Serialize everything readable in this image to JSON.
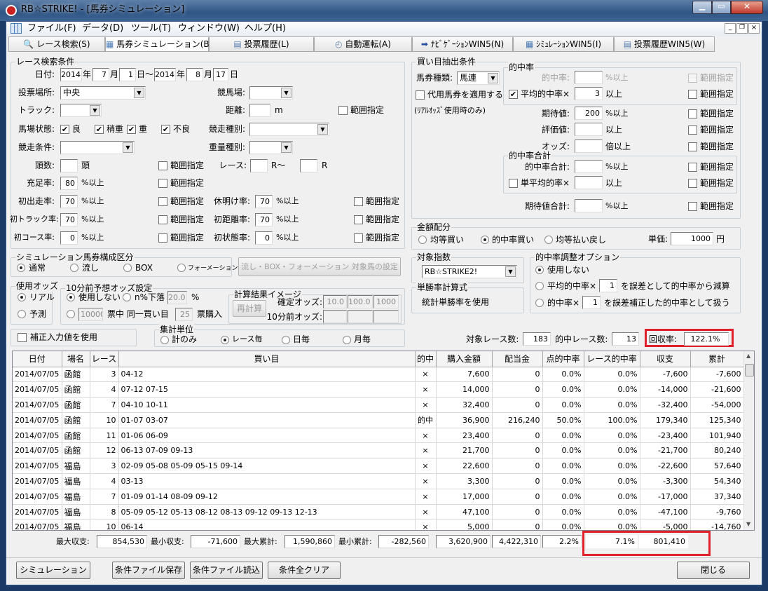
{
  "window": {
    "title": "RB☆STRIKE! - [馬券シミュレーション]",
    "controls": [
      "minimize",
      "maximize",
      "close"
    ]
  },
  "menu": [
    "ファイル(F)",
    "データ(D)",
    "ツール(T)",
    "ウィンドウ(W)",
    "ヘルプ(H)"
  ],
  "tabs": [
    {
      "label": "レース検索(S)",
      "icon": "search-icon"
    },
    {
      "label": "馬券シミュレーション(B)",
      "icon": "grid-icon"
    },
    {
      "label": "投票履歴(L)",
      "icon": "document-icon"
    },
    {
      "label": "自動運転(A)",
      "icon": "clock-icon"
    },
    {
      "label": "ﾅﾋﾞｹﾞｰｼｮﾝWIN5(N)",
      "icon": "arrow-icon"
    },
    {
      "label": "ｼﾐｭﾚｰｼｮﾝWIN5(I)",
      "icon": "grid-icon"
    },
    {
      "label": "投票履歴WIN5(W)",
      "icon": "document-icon"
    }
  ],
  "race": {
    "title": "レース検索条件",
    "date_label": "日付:",
    "y1": "2014",
    "nen": "年",
    "m1": "7",
    "gatsu": "月",
    "d1": "1",
    "nichi_kara": "日～",
    "y2": "2014",
    "m2": "8",
    "d2": "17",
    "nichi": "日",
    "venue_label": "投票場所:",
    "venue": "中央",
    "course_label": "競馬場:",
    "course": "",
    "track_label": "トラック:",
    "track": "",
    "dist_label": "距離:",
    "dist": "",
    "dist_unit": "m",
    "range": "範囲指定",
    "cond_label": "馬場状態:",
    "conds": [
      {
        "label": "良",
        "checked": true
      },
      {
        "label": "稍重",
        "checked": true
      },
      {
        "label": "重",
        "checked": true
      },
      {
        "label": "不良",
        "checked": true
      }
    ],
    "type_label": "競走種別:",
    "type": "",
    "race_cond_label": "競走条件:",
    "race_cond": "",
    "weight_label": "重量種別:",
    "weight": "",
    "heads_label": "頭数:",
    "heads": "",
    "heads_unit": "頭",
    "race_label": "レース:",
    "race_from": "",
    "r_from": "R～",
    "race_to": "",
    "r_to": "R",
    "fill_label": "充足率:",
    "fill": "80",
    "pct_up": "%以上",
    "first_run_label": "初出走率:",
    "first_run": "70",
    "rest_label": "休明け率:",
    "rest": "70",
    "first_track_label": "初トラック率:",
    "first_track": "70",
    "first_dist_label": "初距離率:",
    "first_dist": "70",
    "first_course_label": "初コース率:",
    "first_course": "0",
    "first_state_label": "初状態率:",
    "first_state": "0"
  },
  "sim": {
    "title": "シミュレーション馬券構成区分",
    "options": [
      "通常",
      "流し",
      "BOX",
      "フォーメーション"
    ],
    "selected": "通常",
    "setup_button": "流し・BOX・フォーメーション 対象馬の設定"
  },
  "odds": {
    "title": "使用オッズ",
    "options": [
      "リアル",
      "予測"
    ],
    "selected": "リアル"
  },
  "pre10": {
    "title": "10分前予想オッズ設定",
    "none": "使用しない",
    "drop": "n%下落",
    "drop_val": "20.0",
    "pct": "%",
    "count": "10000",
    "mid": "票中 同一買い目",
    "buy": "25",
    "buy_unit": "票購入",
    "selected": "使用しない"
  },
  "calc": {
    "title": "計算結果イメージ",
    "recalc": "再計算",
    "fixed_label": "確定オッズ:",
    "fixed": [
      "10.0",
      "100.0",
      "1000"
    ],
    "pre_label": "10分前オッズ:",
    "pre": [
      "",
      "",
      ""
    ]
  },
  "correction": {
    "label": "補正入力値を使用",
    "checked": false
  },
  "agg": {
    "title": "集計単位",
    "options": [
      "計のみ",
      "レース毎",
      "日毎",
      "月毎"
    ],
    "selected": "レース毎"
  },
  "buy": {
    "title": "買い目抽出条件",
    "kind_label": "馬券種類:",
    "kind": "馬連",
    "sub_label": "代用馬券を適用する",
    "sub_note": "(ﾘｱﾙｵｯｽﾞ使用時のみ)",
    "hit_group": "的中率",
    "hit_label": "的中率:",
    "hit": "",
    "avg_label": "平均的中率×",
    "avg": "3",
    "avg_checked": true,
    "pct_up": "%以上",
    "up": "以上",
    "times_up": "倍以上",
    "range": "範囲指定",
    "ev_label": "期待値:",
    "ev": "200",
    "score_label": "評価値:",
    "score": "",
    "odds_label": "オッズ:",
    "odds": "",
    "sum_group": "的中率合計",
    "sum_label": "的中率合計:",
    "sum": "",
    "single_label": "単平均的率×",
    "single": "",
    "ev_sum_label": "期待値合計:",
    "ev_sum": ""
  },
  "money": {
    "title": "金額配分",
    "options": [
      "均等買い",
      "的中率買い",
      "均等払い戻し"
    ],
    "selected": "的中率買い",
    "unit_label": "単価:",
    "unit": "1000",
    "yen": "円"
  },
  "index": {
    "title": "対象指数",
    "value": "RB☆STRIKE2!"
  },
  "winrate": {
    "title": "単勝率計算式",
    "value": "統計単勝率を使用"
  },
  "adjust": {
    "title": "的中率調整オプション",
    "none": "使用しない",
    "opt1_pre": "平均的中率×",
    "opt1_val": "1",
    "opt1_post": "を誤差として的中率から減算",
    "opt2_pre": "的中率×",
    "opt2_val": "1",
    "opt2_post": "を誤差補正した的中率として扱う",
    "selected": "使用しない"
  },
  "stats": {
    "races_label": "対象レース数:",
    "races": "183",
    "hits_label": "的中レース数:",
    "hits": "13",
    "return_label": "回収率:",
    "return": "122.1%"
  },
  "table": {
    "headers": [
      "日付",
      "場名",
      "レース",
      "買い目",
      "的中",
      "購入金額",
      "配当金",
      "点的中率",
      "レース的中率",
      "収支",
      "累計"
    ],
    "rows": [
      [
        "2014/07/05",
        "函館",
        "3",
        "04-12",
        "×",
        "7,600",
        "0",
        "0.0%",
        "0.0%",
        "-7,600",
        "-7,600"
      ],
      [
        "2014/07/05",
        "函館",
        "4",
        "07-12 07-15",
        "×",
        "14,000",
        "0",
        "0.0%",
        "0.0%",
        "-14,000",
        "-21,600"
      ],
      [
        "2014/07/05",
        "函館",
        "7",
        "04-10 10-11",
        "×",
        "32,400",
        "0",
        "0.0%",
        "0.0%",
        "-32,400",
        "-54,000"
      ],
      [
        "2014/07/05",
        "函館",
        "10",
        "01-07 03-07",
        "的中",
        "36,900",
        "216,240",
        "50.0%",
        "100.0%",
        "179,340",
        "125,340"
      ],
      [
        "2014/07/05",
        "函館",
        "11",
        "01-06 06-09",
        "×",
        "23,400",
        "0",
        "0.0%",
        "0.0%",
        "-23,400",
        "101,940"
      ],
      [
        "2014/07/05",
        "函館",
        "12",
        "06-13 07-09 09-13",
        "×",
        "21,700",
        "0",
        "0.0%",
        "0.0%",
        "-21,700",
        "80,240"
      ],
      [
        "2014/07/05",
        "福島",
        "3",
        "02-09 05-08 05-09 05-15 09-14",
        "×",
        "22,600",
        "0",
        "0.0%",
        "0.0%",
        "-22,600",
        "57,640"
      ],
      [
        "2014/07/05",
        "福島",
        "4",
        "03-13",
        "×",
        "3,300",
        "0",
        "0.0%",
        "0.0%",
        "-3,300",
        "54,340"
      ],
      [
        "2014/07/05",
        "福島",
        "7",
        "01-09 01-14 08-09 09-12",
        "×",
        "17,000",
        "0",
        "0.0%",
        "0.0%",
        "-17,000",
        "37,340"
      ],
      [
        "2014/07/05",
        "福島",
        "8",
        "05-09 05-12 05-13 08-12 08-13 09-12 09-13 12-13",
        "×",
        "47,100",
        "0",
        "0.0%",
        "0.0%",
        "-47,100",
        "-9,760"
      ],
      [
        "2014/07/05",
        "福島",
        "10",
        "06-14",
        "×",
        "5,000",
        "0",
        "0.0%",
        "0.0%",
        "-5,000",
        "-14,760"
      ]
    ]
  },
  "summary": {
    "max_profit_label": "最大収支:",
    "max_profit": "854,530",
    "min_profit_label": "最小収支:",
    "min_profit": "-71,600",
    "max_cum_label": "最大累計:",
    "max_cum": "1,590,860",
    "min_cum_label": "最小累計:",
    "min_cum": "-282,560",
    "total_buy": "3,620,900",
    "total_pay": "4,422,310",
    "point_hit": "2.2%",
    "race_hit": "7.1%",
    "profit": "801,410"
  },
  "buttons": {
    "simulate": "シミュレーション",
    "save": "条件ファイル保存",
    "load": "条件ファイル読込",
    "clear": "条件全クリア",
    "close": "閉じる"
  },
  "colors": {
    "highlight": "#e0202a",
    "titlebar": "#2f5585"
  }
}
